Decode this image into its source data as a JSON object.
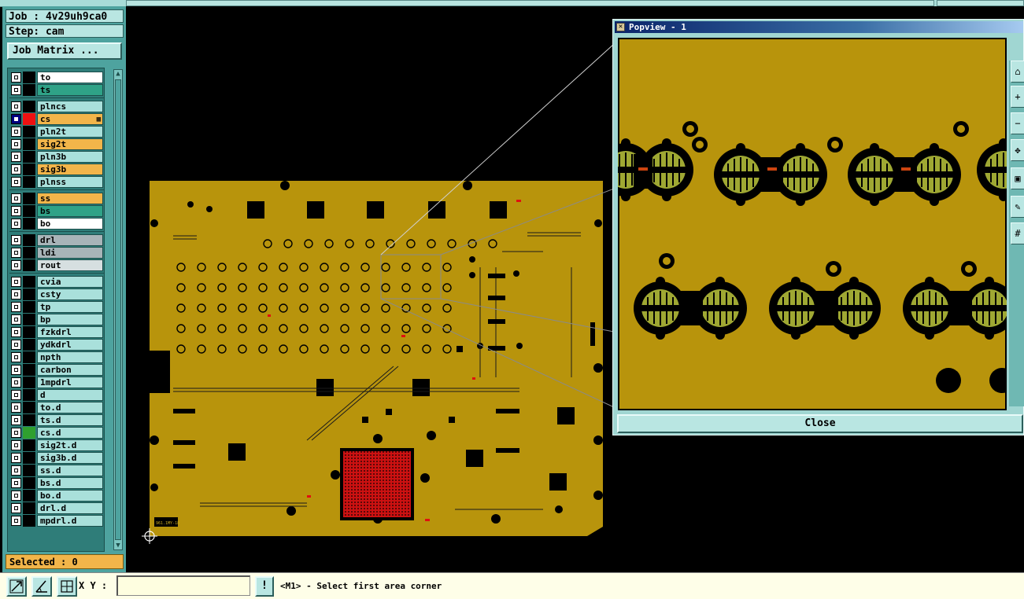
{
  "job": {
    "label": "Job : 4v29uh9ca0"
  },
  "step": {
    "label": "Step: cam"
  },
  "job_matrix_button": "Job Matrix ...",
  "colors": {
    "panel": "#4ea39f",
    "pcb_body": "#b8940c",
    "pcb_copper": "#9fa833",
    "active_red": "#ee1111",
    "white": "#ffffff",
    "teal": "#2fa287",
    "cyan": "#a9e0db",
    "orange": "#f2b54a",
    "gray": "#a8b4b8",
    "light": "#d6dfe0",
    "green": "#2fa02f"
  },
  "layers": [
    {
      "name": "to",
      "color": "white",
      "state": "none",
      "group": 1
    },
    {
      "name": "ts",
      "color": "teal",
      "state": "none",
      "group": 1
    },
    {
      "name": "plncs",
      "color": "cyan",
      "state": "none",
      "group": 2
    },
    {
      "name": "cs",
      "color": "orange",
      "state": "active",
      "group": 2,
      "has_marker": true
    },
    {
      "name": "pln2t",
      "color": "cyan",
      "state": "none",
      "group": 2
    },
    {
      "name": "sig2t",
      "color": "orange",
      "state": "none",
      "group": 2
    },
    {
      "name": "pln3b",
      "color": "cyan",
      "state": "none",
      "group": 2
    },
    {
      "name": "sig3b",
      "color": "orange",
      "state": "none",
      "group": 2
    },
    {
      "name": "plnss",
      "color": "cyan",
      "state": "none",
      "group": 2
    },
    {
      "name": "ss",
      "color": "orange",
      "state": "none",
      "group": 3
    },
    {
      "name": "bs",
      "color": "teal",
      "state": "none",
      "group": 3
    },
    {
      "name": "bo",
      "color": "white",
      "state": "none",
      "group": 3
    },
    {
      "name": "drl",
      "color": "gray",
      "state": "none",
      "group": 4
    },
    {
      "name": "ldi",
      "color": "gray",
      "state": "none",
      "group": 4
    },
    {
      "name": "rout",
      "color": "light",
      "state": "none",
      "group": 4
    },
    {
      "name": "cvia",
      "color": "cyan",
      "state": "none",
      "group": 5
    },
    {
      "name": "csty",
      "color": "cyan",
      "state": "none",
      "group": 5
    },
    {
      "name": "tp",
      "color": "cyan",
      "state": "none",
      "group": 5
    },
    {
      "name": "bp",
      "color": "cyan",
      "state": "none",
      "group": 5
    },
    {
      "name": "fzkdrl",
      "color": "cyan",
      "state": "none",
      "group": 5
    },
    {
      "name": "ydkdrl",
      "color": "cyan",
      "state": "none",
      "group": 5
    },
    {
      "name": "npth",
      "color": "cyan",
      "state": "none",
      "group": 5
    },
    {
      "name": "carbon",
      "color": "cyan",
      "state": "none",
      "group": 5
    },
    {
      "name": "1mpdrl",
      "color": "cyan",
      "state": "none",
      "group": 5
    },
    {
      "name": "d",
      "color": "cyan",
      "state": "none",
      "group": 5
    },
    {
      "name": "to.d",
      "color": "cyan",
      "state": "none",
      "group": 5
    },
    {
      "name": "ts.d",
      "color": "cyan",
      "state": "none",
      "group": 5
    },
    {
      "name": "cs.d",
      "color": "cyan",
      "state": "affected",
      "group": 5
    },
    {
      "name": "sig2t.d",
      "color": "cyan",
      "state": "none",
      "group": 5
    },
    {
      "name": "sig3b.d",
      "color": "cyan",
      "state": "none",
      "group": 5
    },
    {
      "name": "ss.d",
      "color": "cyan",
      "state": "none",
      "group": 5
    },
    {
      "name": "bs.d",
      "color": "cyan",
      "state": "none",
      "group": 5
    },
    {
      "name": "bo.d",
      "color": "cyan",
      "state": "none",
      "group": 5
    },
    {
      "name": "drl.d",
      "color": "cyan",
      "state": "none",
      "group": 5
    },
    {
      "name": "mpdrl.d",
      "color": "cyan",
      "state": "none",
      "group": 5
    }
  ],
  "selected": {
    "label": "Selected : 0"
  },
  "popview": {
    "title": "Popview - 1",
    "close_label": "Close",
    "toolbar_icons": [
      "zoom-home-icon",
      "zoom-in-icon",
      "zoom-out-icon",
      "pan-icon",
      "fit-icon",
      "measure-icon",
      "grid-icon"
    ]
  },
  "board": {
    "silk_text": "961.1MY-18"
  },
  "bottom": {
    "xy_label": "X Y :",
    "xy_value": "",
    "info_label": "!",
    "prompt": "<M1> - Select first area corner"
  }
}
